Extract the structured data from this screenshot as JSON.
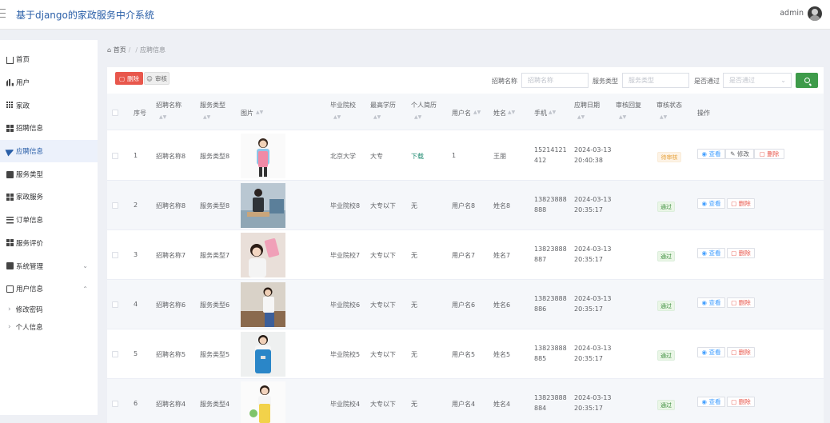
{
  "app": {
    "title": "基于django的家政服务中介系统",
    "user": "admin"
  },
  "sidebar": {
    "items": [
      {
        "label": "首页",
        "icon": "home-icon",
        "name": "home"
      },
      {
        "label": "用户",
        "icon": "bar-chart-icon",
        "name": "users"
      },
      {
        "label": "家政",
        "icon": "grid-icon",
        "name": "housekeeping"
      },
      {
        "label": "招聘信息",
        "icon": "apps-icon",
        "name": "recruit-info"
      },
      {
        "label": "应聘信息",
        "icon": "send-icon",
        "name": "apply-info"
      },
      {
        "label": "服务类型",
        "icon": "briefcase-icon",
        "name": "service-type"
      },
      {
        "label": "家政服务",
        "icon": "apps-icon",
        "name": "housekeeping-service"
      },
      {
        "label": "订单信息",
        "icon": "list-icon",
        "name": "order-info"
      },
      {
        "label": "服务评价",
        "icon": "apps-icon",
        "name": "service-review"
      },
      {
        "label": "系统管理",
        "icon": "message-icon",
        "name": "system-management"
      },
      {
        "label": "用户信息",
        "icon": "user-icon",
        "name": "user-info"
      }
    ],
    "sub_items": [
      {
        "label": "修改密码"
      },
      {
        "label": "个人信息"
      }
    ]
  },
  "breadcrumb": {
    "home": "首页",
    "current": "应聘信息"
  },
  "toolbar": {
    "delete_label": "删除",
    "audit_label": "审核",
    "filters": [
      {
        "label": "招聘名称",
        "placeholder": "招聘名称"
      },
      {
        "label": "服务类型",
        "placeholder": "服务类型"
      },
      {
        "label": "是否通过",
        "placeholder": "是否通过"
      }
    ]
  },
  "table": {
    "headers": [
      "序号",
      "招聘名称",
      "服务类型",
      "图片",
      "毕业院校",
      "最高学历",
      "个人简历",
      "用户名",
      "姓名",
      "手机",
      "应聘日期",
      "审核回复",
      "审核状态",
      "操作"
    ],
    "action_labels": {
      "view": "查看",
      "edit": "修改",
      "delete": "删除"
    },
    "rows": [
      {
        "no": "1",
        "title": "招聘名称8",
        "service": "服务类型8",
        "school": "北京大学",
        "edu": "大专",
        "resume": "下载",
        "username": "1",
        "name": "王朋",
        "phone": "15214121412",
        "date": "2024-03-13 20:40:38",
        "reply": "",
        "status": "待审核"
      },
      {
        "no": "2",
        "title": "招聘名称8",
        "service": "服务类型8",
        "school": "毕业院校8",
        "edu": "大专以下",
        "resume": "无",
        "username": "用户名8",
        "name": "姓名8",
        "phone": "13823888888",
        "date": "2024-03-13 20:35:17",
        "reply": "",
        "status": "通过"
      },
      {
        "no": "3",
        "title": "招聘名称7",
        "service": "服务类型7",
        "school": "毕业院校7",
        "edu": "大专以下",
        "resume": "无",
        "username": "用户名7",
        "name": "姓名7",
        "phone": "13823888887",
        "date": "2024-03-13 20:35:17",
        "reply": "",
        "status": "通过"
      },
      {
        "no": "4",
        "title": "招聘名称6",
        "service": "服务类型6",
        "school": "毕业院校6",
        "edu": "大专以下",
        "resume": "无",
        "username": "用户名6",
        "name": "姓名6",
        "phone": "13823888886",
        "date": "2024-03-13 20:35:17",
        "reply": "",
        "status": "通过"
      },
      {
        "no": "5",
        "title": "招聘名称5",
        "service": "服务类型5",
        "school": "毕业院校5",
        "edu": "大专以下",
        "resume": "无",
        "username": "用户名5",
        "name": "姓名5",
        "phone": "13823888885",
        "date": "2024-03-13 20:35:17",
        "reply": "",
        "status": "通过"
      },
      {
        "no": "6",
        "title": "招聘名称4",
        "service": "服务类型4",
        "school": "毕业院校4",
        "edu": "大专以下",
        "resume": "无",
        "username": "用户名4",
        "name": "姓名4",
        "phone": "13823888884",
        "date": "2024-03-13 20:35:17",
        "reply": "",
        "status": "通过"
      }
    ]
  }
}
